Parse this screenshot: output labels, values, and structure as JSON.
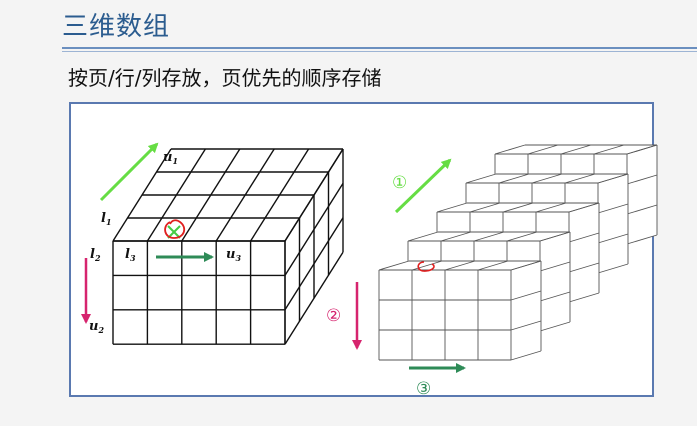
{
  "page": {
    "title": "三维数组",
    "subtitle": "按页/行/列存放，页优先的顺序存储"
  },
  "diagram": {
    "labels": {
      "u1": "u",
      "u1_sub": "1",
      "l1": "l",
      "l1_sub": "1",
      "l2": "l",
      "l2_sub": "2",
      "l3": "l",
      "l3_sub": "3",
      "u3": "u",
      "u3_sub": "3",
      "u2": "u",
      "u2_sub": "2"
    },
    "steps": {
      "step1": "①",
      "step2": "②",
      "step3": "③"
    },
    "colors": {
      "title": "#2b5c8f",
      "frame": "#5a79b0",
      "green_light": "#66dd44",
      "green_dark": "#2e8b57",
      "magenta": "#d6246e",
      "annotation_red": "#e02020"
    },
    "icons": [
      "arrow-icon",
      "cross-mark-icon",
      "circle-annotation-icon"
    ]
  }
}
